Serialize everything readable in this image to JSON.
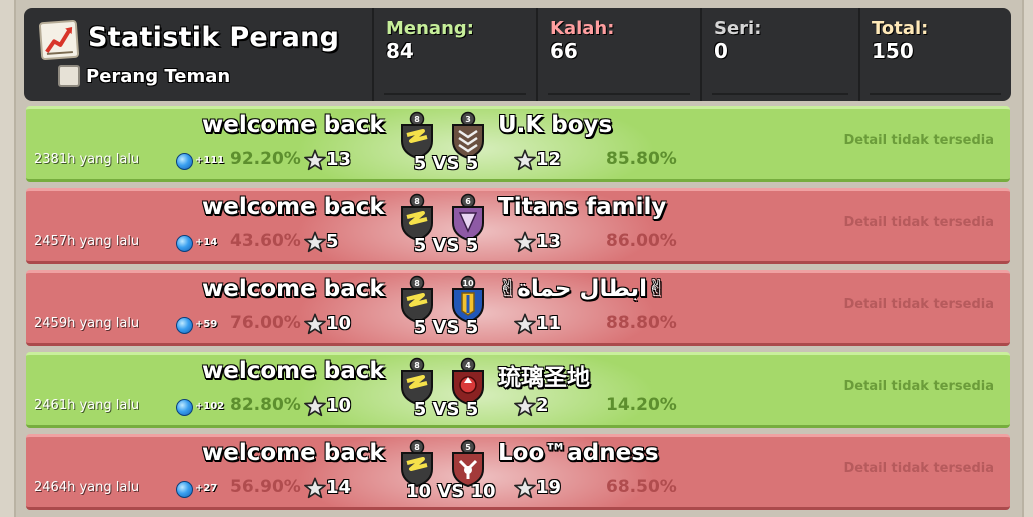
{
  "header": {
    "title": "Statistik Perang",
    "friendly_label": "Perang Teman",
    "stats": [
      {
        "label": "Menang:",
        "value": "84"
      },
      {
        "label": "Kalah:",
        "value": "66"
      },
      {
        "label": "Seri:",
        "value": "0"
      },
      {
        "label": "Total:",
        "value": "150"
      }
    ]
  },
  "colors": {
    "win_row": "#a5d96a",
    "lose_row": "#d97476"
  },
  "wars": [
    {
      "result": "win",
      "clan": "welcome back",
      "opponent": "U.K boys",
      "ago": "2381h yang lalu",
      "xp": "+111",
      "our_pct": "92.20%",
      "our_stars": "13",
      "vs": "5 VS 5",
      "opp_stars": "12",
      "opp_pct": "85.80%",
      "detail": "Detail tidak tersedia",
      "our_level": "8",
      "opp_level": "3"
    },
    {
      "result": "lose",
      "clan": "welcome back",
      "opponent": "Titans family",
      "ago": "2457h yang lalu",
      "xp": "+14",
      "our_pct": "43.60%",
      "our_stars": "5",
      "vs": "5 VS 5",
      "opp_stars": "13",
      "opp_pct": "86.00%",
      "detail": "Detail tidak tersedia",
      "our_level": "8",
      "opp_level": "6"
    },
    {
      "result": "lose",
      "clan": "welcome back",
      "opponent": "✌ابطال حماة✌",
      "ago": "2459h yang lalu",
      "xp": "+59",
      "our_pct": "76.00%",
      "our_stars": "10",
      "vs": "5 VS 5",
      "opp_stars": "11",
      "opp_pct": "88.80%",
      "detail": "Detail tidak tersedia",
      "our_level": "8",
      "opp_level": "10"
    },
    {
      "result": "win",
      "clan": "welcome back",
      "opponent": "琉璃圣地",
      "ago": "2461h yang lalu",
      "xp": "+102",
      "our_pct": "82.80%",
      "our_stars": "10",
      "vs": "5 VS 5",
      "opp_stars": "2",
      "opp_pct": "14.20%",
      "detail": "Detail tidak tersedia",
      "our_level": "8",
      "opp_level": "4"
    },
    {
      "result": "lose",
      "clan": "welcome back",
      "opponent": "Loo™adness",
      "ago": "2464h yang lalu",
      "xp": "+27",
      "our_pct": "56.90%",
      "our_stars": "14",
      "vs": "10 VS 10",
      "opp_stars": "19",
      "opp_pct": "68.50%",
      "detail": "Detail tidak tersedia",
      "our_level": "8",
      "opp_level": "5"
    }
  ]
}
